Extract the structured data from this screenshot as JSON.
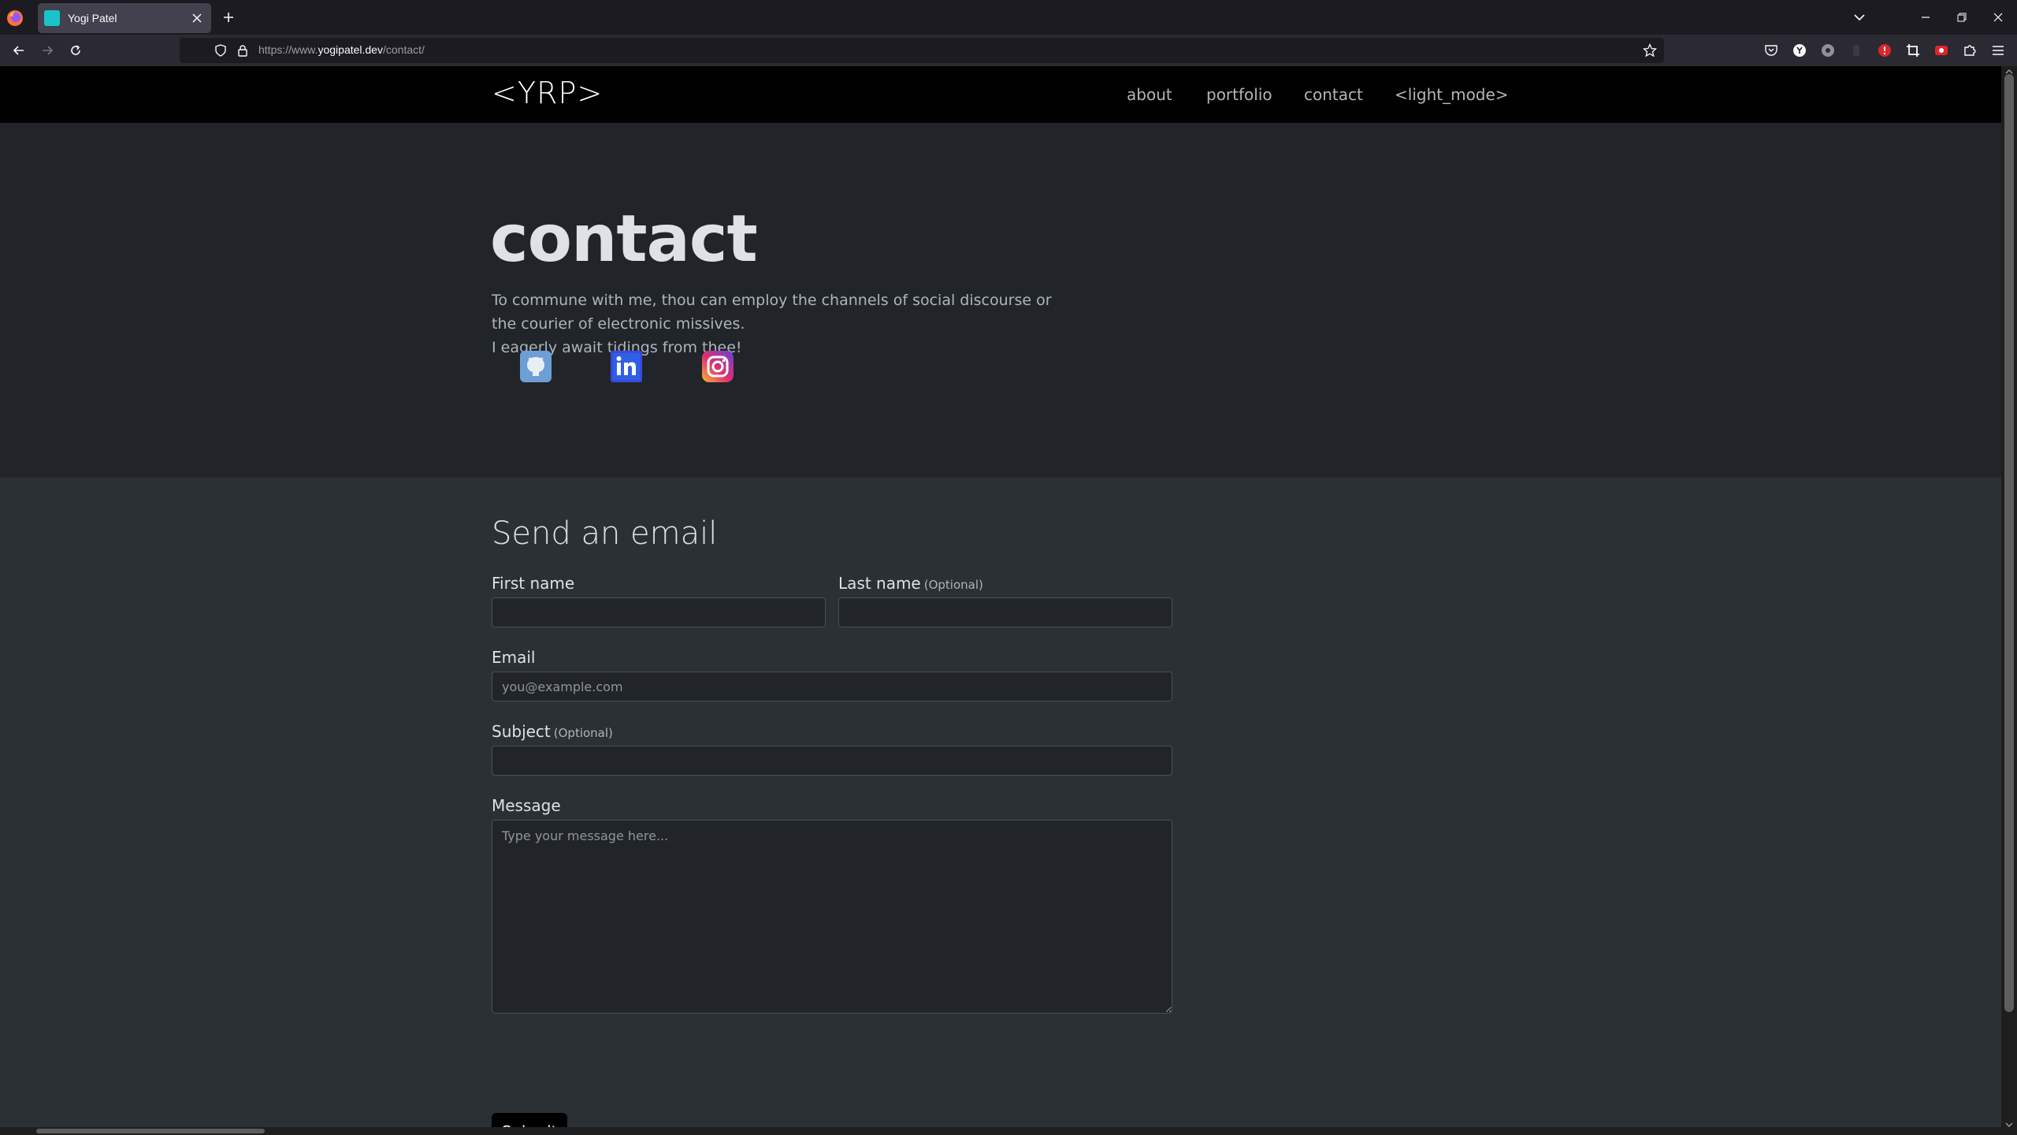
{
  "browser": {
    "tab_title": "Yogi Patel",
    "url_prefix": "https://www.",
    "url_domain": "yogipatel.dev",
    "url_path": "/contact/",
    "icons": {
      "back": "arrow-left-icon",
      "forward": "arrow-right-icon",
      "reload": "reload-icon",
      "bookmark": "star-icon",
      "menu": "hamburger-icon"
    }
  },
  "site": {
    "brand": "<YRP>",
    "nav": [
      "about",
      "portfolio",
      "contact",
      "<light_mode>"
    ]
  },
  "hero": {
    "title": "contact",
    "lines": [
      "To commune with me, thou can employ the channels of social discourse or",
      "the courier of electronic missives.",
      "I eagerly await tidings from thee!"
    ],
    "social": [
      "github-icon",
      "linkedin-icon",
      "instagram-icon"
    ]
  },
  "form": {
    "title": "Send an email",
    "first_name_label": "First name",
    "last_name_label": "Last name",
    "optional": "(Optional)",
    "email_label": "Email",
    "email_placeholder": "you@example.com",
    "subject_label": "Subject",
    "message_label": "Message",
    "message_placeholder": "Type your message here...",
    "submit": "Submit"
  },
  "colors": {
    "nav_bg": "#000000",
    "hero_bg": "#212529",
    "form_bg": "#2b3035",
    "field_bg": "#212529",
    "field_border": "#495057"
  }
}
